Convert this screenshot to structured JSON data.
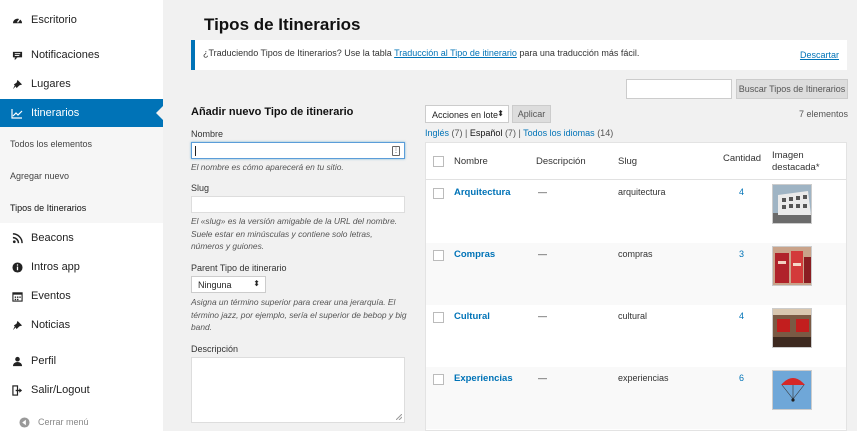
{
  "sidebar": {
    "items": [
      {
        "label": "Escritorio",
        "icon": "dashboard-icon"
      },
      {
        "label": "Notificaciones",
        "icon": "notifications-icon"
      },
      {
        "label": "Lugares",
        "icon": "pin-icon"
      },
      {
        "label": "Itinerarios",
        "icon": "chart-line-icon"
      },
      {
        "label": "Beacons",
        "icon": "rss-icon"
      },
      {
        "label": "Intros app",
        "icon": "info-icon"
      },
      {
        "label": "Eventos",
        "icon": "calendar-icon"
      },
      {
        "label": "Noticias",
        "icon": "pin-icon"
      },
      {
        "label": "Perfil",
        "icon": "user-icon"
      },
      {
        "label": "Salir/Logout",
        "icon": "logout-icon"
      }
    ],
    "submenu": [
      "Todos los elementos",
      "Agregar nuevo",
      "Tipos de Itinerarios"
    ],
    "collapse_label": "Cerrar menú"
  },
  "page": {
    "title": "Tipos de Itinerarios"
  },
  "notice": {
    "text_before": "¿Traduciendo Tipos de Itinerarios? Use la tabla ",
    "link": "Traducción al Tipo de itinerario",
    "text_after": " para una traducción más fácil.",
    "dismiss": "Descartar"
  },
  "search": {
    "value": "",
    "button": "Buscar Tipos de Itinerarios"
  },
  "form": {
    "title": "Añadir nuevo Tipo de itinerario",
    "name_label": "Nombre",
    "name_value": "",
    "name_help": "El nombre es cómo aparecerá en tu sitio.",
    "slug_label": "Slug",
    "slug_value": "",
    "slug_help": "El «slug» es la versión amigable de la URL del nombre. Suele estar en minúsculas y contiene solo letras, números y guiones.",
    "parent_label": "Parent Tipo de itinerario",
    "parent_value": "Ninguna",
    "parent_help": "Asigna un término superior para crear una jerarquía. El término jazz, por ejemplo, sería el superior de bebop y big band.",
    "desc_label": "Descripción"
  },
  "bulk": {
    "actions": "Acciones en lote",
    "apply": "Aplicar",
    "count": "7 elementos"
  },
  "languages": [
    {
      "label": "Inglés",
      "count": "(7)"
    },
    {
      "label": "Español",
      "count": "(7)"
    },
    {
      "label": "Todos los idiomas",
      "count": "(14)"
    }
  ],
  "table": {
    "headers": {
      "name": "Nombre",
      "description": "Descripción",
      "slug": "Slug",
      "count": "Cantidad",
      "image": "Imagen destacada*"
    },
    "rows": [
      {
        "name": "Arquitectura",
        "description": "—",
        "slug": "arquitectura",
        "count": "4",
        "image": "architecture-photo"
      },
      {
        "name": "Compras",
        "description": "—",
        "slug": "compras",
        "count": "3",
        "image": "shopping-photo"
      },
      {
        "name": "Cultural",
        "description": "—",
        "slug": "cultural",
        "count": "4",
        "image": "gallery-photo"
      },
      {
        "name": "Experiencias",
        "description": "—",
        "slug": "experiencias",
        "count": "6",
        "image": "parachute-photo"
      }
    ]
  },
  "colors": {
    "accent": "#0073b7",
    "sidebar_bg": "#ffffff",
    "page_bg": "#f1f1f1"
  }
}
